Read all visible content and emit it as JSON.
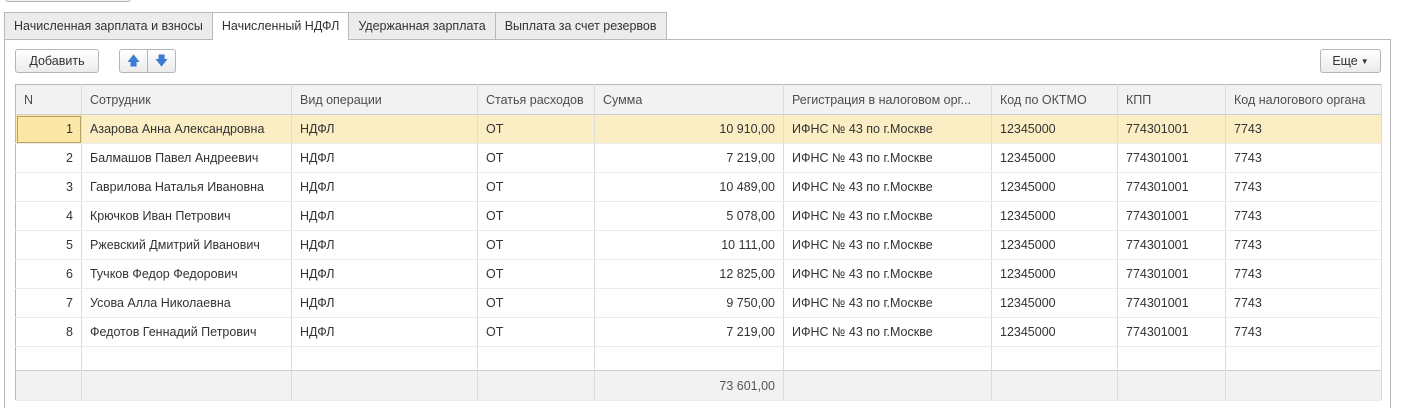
{
  "tabs": [
    {
      "label": "Начисленная зарплата и взносы",
      "active": false
    },
    {
      "label": "Начисленный НДФЛ",
      "active": true
    },
    {
      "label": "Удержанная зарплата",
      "active": false
    },
    {
      "label": "Выплата за счет резервов",
      "active": false
    }
  ],
  "toolbar": {
    "add_label": "Добавить",
    "up_icon": "arrow-up-icon",
    "down_icon": "arrow-down-icon",
    "more_label": "Еще"
  },
  "colors": {
    "selected_row": "#fbeec4",
    "arrow": "#3b7bd4"
  },
  "table": {
    "columns": [
      "N",
      "Сотрудник",
      "Вид операции",
      "Статья расходов",
      "Сумма",
      "Регистрация в налоговом орг...",
      "Код по ОКТМО",
      "КПП",
      "Код налогового органа"
    ],
    "rows": [
      [
        "1",
        "Азарова Анна Александровна",
        "НДФЛ",
        "ОТ",
        "10 910,00",
        "ИФНС № 43 по г.Москве",
        "12345000",
        "774301001",
        "7743"
      ],
      [
        "2",
        "Балмашов Павел Андреевич",
        "НДФЛ",
        "ОТ",
        "7 219,00",
        "ИФНС № 43 по г.Москве",
        "12345000",
        "774301001",
        "7743"
      ],
      [
        "3",
        "Гаврилова Наталья Ивановна",
        "НДФЛ",
        "ОТ",
        "10 489,00",
        "ИФНС № 43 по г.Москве",
        "12345000",
        "774301001",
        "7743"
      ],
      [
        "4",
        "Крючков Иван Петрович",
        "НДФЛ",
        "ОТ",
        "5 078,00",
        "ИФНС № 43 по г.Москве",
        "12345000",
        "774301001",
        "7743"
      ],
      [
        "5",
        "Ржевский Дмитрий Иванович",
        "НДФЛ",
        "ОТ",
        "10 111,00",
        "ИФНС № 43 по г.Москве",
        "12345000",
        "774301001",
        "7743"
      ],
      [
        "6",
        "Тучков Федор Федорович",
        "НДФЛ",
        "ОТ",
        "12 825,00",
        "ИФНС № 43 по г.Москве",
        "12345000",
        "774301001",
        "7743"
      ],
      [
        "7",
        "Усова Алла Николаевна",
        "НДФЛ",
        "ОТ",
        "9 750,00",
        "ИФНС № 43 по г.Москве",
        "12345000",
        "774301001",
        "7743"
      ],
      [
        "8",
        "Федотов Геннадий Петрович",
        "НДФЛ",
        "ОТ",
        "7 219,00",
        "ИФНС № 43 по г.Москве",
        "12345000",
        "774301001",
        "7743"
      ]
    ],
    "selected_row": 0,
    "total_sum": "73 601,00"
  }
}
